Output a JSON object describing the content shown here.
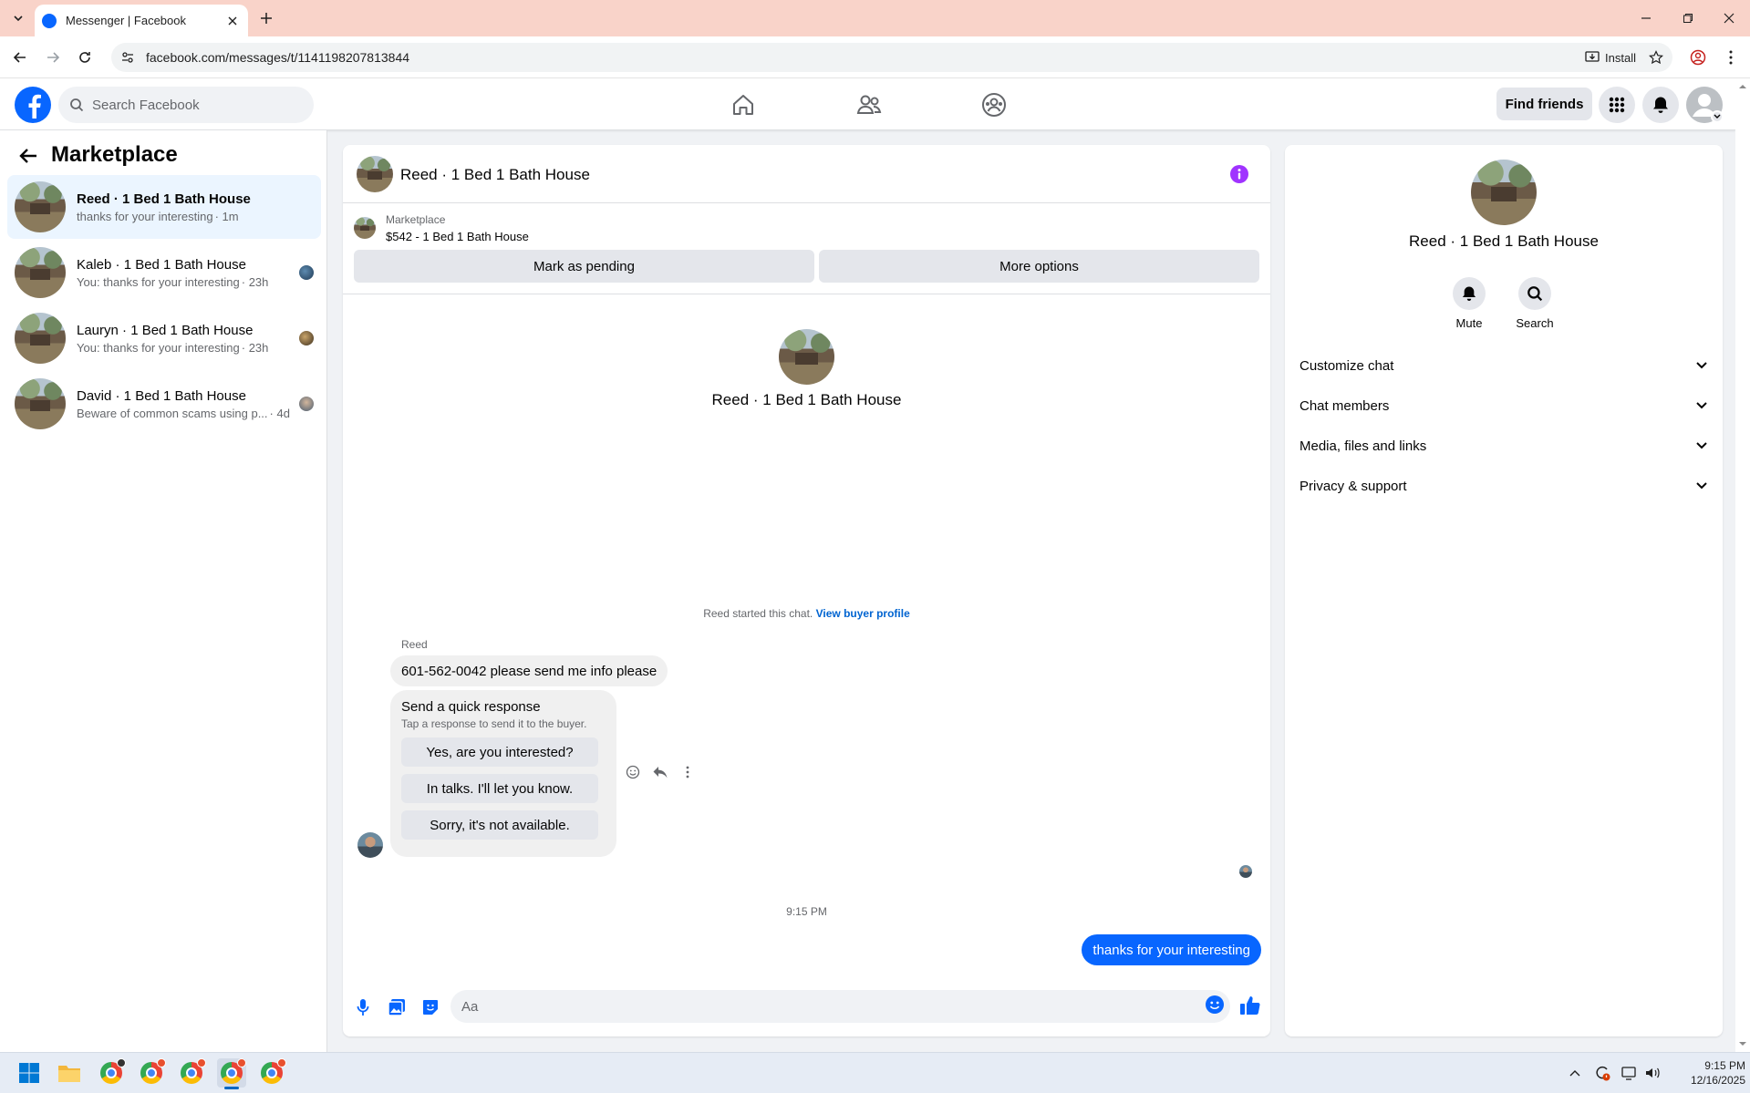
{
  "browser": {
    "tab_title": "Messenger | Facebook",
    "url": "facebook.com/messages/t/1141198207813844",
    "install_label": "Install"
  },
  "fb_header": {
    "search_placeholder": "Search Facebook",
    "find_friends_label": "Find friends"
  },
  "sidebar": {
    "title": "Marketplace",
    "conversations": [
      {
        "name": "Reed · 1 Bed 1 Bath House",
        "preview": "thanks for your interesting",
        "time": "· 1m",
        "active": true
      },
      {
        "name": "Kaleb · 1 Bed 1 Bath House",
        "preview": "You: thanks for your interesting",
        "time": "· 23h",
        "active": false
      },
      {
        "name": "Lauryn · 1 Bed 1 Bath House",
        "preview": "You: thanks for your interesting",
        "time": "· 23h",
        "active": false
      },
      {
        "name": "David · 1 Bed 1 Bath House",
        "preview": "Beware of common scams using p...",
        "time": "· 4d",
        "active": false
      }
    ]
  },
  "chat": {
    "title": "Reed · 1 Bed 1 Bath House",
    "listing": {
      "source": "Marketplace",
      "description": "$542 - 1 Bed 1 Bath House",
      "mark_pending_label": "Mark as pending",
      "more_options_label": "More options"
    },
    "intro_name": "Reed · 1 Bed 1 Bath House",
    "started_text": "Reed started this chat.",
    "view_profile_label": "View buyer profile",
    "sender_name": "Reed",
    "incoming_message": "601-562-0042 please send me info please",
    "quick_response": {
      "title": "Send a quick response",
      "subtitle": "Tap a response to send it to the buyer.",
      "options": [
        "Yes, are you interested?",
        "In talks. I'll let you know.",
        "Sorry, it's not available."
      ]
    },
    "time_separator": "9:15 PM",
    "outgoing_message": "thanks for your interesting",
    "composer_placeholder": "Aa"
  },
  "details": {
    "name": "Reed · 1 Bed 1 Bath House",
    "actions": [
      {
        "label": "Mute",
        "icon": "bell-icon"
      },
      {
        "label": "Search",
        "icon": "search-icon"
      }
    ],
    "sections": [
      "Customize chat",
      "Chat members",
      "Media, files and links",
      "Privacy & support"
    ]
  },
  "taskbar": {
    "time": "9:15 PM",
    "date": "12/16/2025"
  },
  "colors": {
    "fb_blue": "#0866ff",
    "tab_bar": "#f9d3c9",
    "info_purple": "#a033ff",
    "active_conv": "#ebf5ff"
  }
}
